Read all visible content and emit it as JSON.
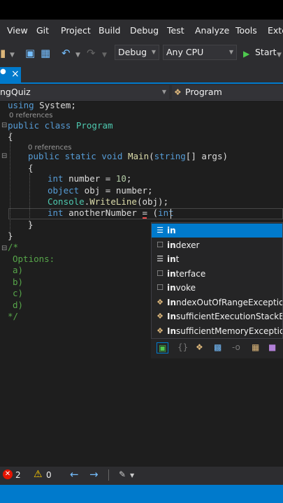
{
  "menu": [
    "View",
    "Git",
    "Project",
    "Build",
    "Debug",
    "Test",
    "Analyze",
    "Tools",
    "Exte"
  ],
  "toolbar": {
    "config": "Debug",
    "platform": "Any CPU",
    "start": "Start"
  },
  "tab": {
    "close": "×"
  },
  "nav": {
    "left": "ngQuiz",
    "right": "Program"
  },
  "code": {
    "l1_kw": "using",
    "l1_rest": " System;",
    "refs": "0 references",
    "l2_kw": "public class ",
    "l2_ty": "Program",
    "brace_open": "{",
    "brace_close": "}",
    "refs2": "0 references",
    "l3_kw": "public static void ",
    "l3_fn": "Main",
    "l3_p1": "(",
    "l3_kw2": "string",
    "l3_p2": "[] args)",
    "l4_kw": "int",
    "l4_rest": " number = ",
    "l4_num": "10",
    "l4_end": ";",
    "l5_kw": "object",
    "l5_rest": " obj = number;",
    "l6_ty": "Console",
    "l6_p": ".",
    "l6_fn": "WriteLine",
    "l6_rest": "(obj);",
    "l7_kw": "int",
    "l7_rest": " anotherNumber = (",
    "l7_kw2": "int",
    "c1": "/*",
    "c2": "Options:",
    "c3": "a)",
    "c4": "b)",
    "c5": "c)",
    "c6": "d)",
    "c7": "*/"
  },
  "completion": [
    {
      "bold": "in",
      "rest": "",
      "icon": "keyword-icon"
    },
    {
      "bold": "in",
      "rest": "dexer",
      "icon": "snippet-icon"
    },
    {
      "bold": "in",
      "rest": "t",
      "icon": "keyword-icon"
    },
    {
      "bold": "in",
      "rest": "terface",
      "icon": "snippet-icon"
    },
    {
      "bold": "in",
      "rest": "voke",
      "icon": "snippet-icon"
    },
    {
      "bold": "I",
      "rest": "ndexOutOfRangeException",
      "bold2": "n",
      "icon": "class-icon"
    },
    {
      "bold": "I",
      "rest": "sufficientExecutionStackExcepti",
      "bold2": "n",
      "icon": "class-icon"
    },
    {
      "bold": "I",
      "rest": "sufficientMemoryException",
      "bold2": "n",
      "icon": "class-icon"
    }
  ],
  "status": {
    "errors": "2",
    "warnings": "0"
  },
  "colors": {
    "accent": "#007acc",
    "keyword": "#569cd6",
    "type": "#4ec9b0",
    "method": "#dcdcaa",
    "comment": "#57a64a"
  }
}
